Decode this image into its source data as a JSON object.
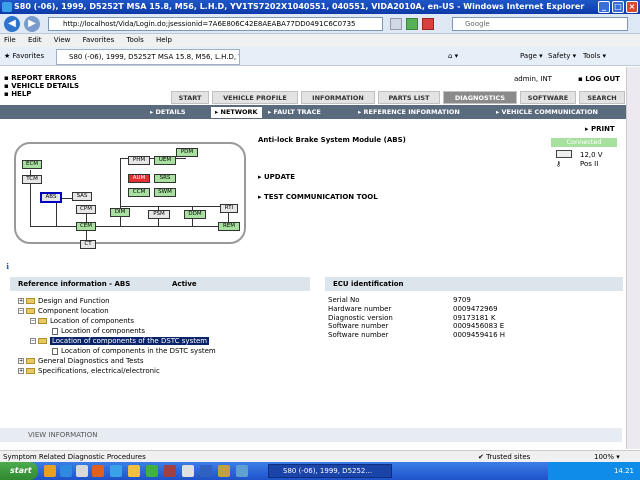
{
  "window": {
    "title": "S80 (-06), 1999, D5252T MSA 15.8, M56, L.H.D, YV1TS7202X1040551, 040551, VIDA2010A, en-US - Windows Internet Explorer"
  },
  "browser": {
    "address": "http://localhost/Vida/Login.do;jsessionid=7A6E806C42E8AEABA77DD0491C6C0735",
    "search_placeholder": "Google",
    "menu": [
      "File",
      "Edit",
      "View",
      "Favorites",
      "Tools",
      "Help"
    ],
    "favorites_label": "Favorites",
    "tab_title": "S80 (-06), 1999, D5252T MSA 15.8, M56, L.H.D, YV1...",
    "toolbar": {
      "page": "Page ▾",
      "safety": "Safety ▾",
      "tools": "Tools ▾"
    },
    "status": "Symptom Related Diagnostic Procedures",
    "zone": "Trusted sites",
    "zoom": "100% ▾"
  },
  "vida": {
    "left_links": [
      "REPORT ERRORS",
      "VEHICLE DETAILS",
      "HELP"
    ],
    "user": "admin, INT",
    "logout": "LOG OUT",
    "tabs": [
      "START",
      "VEHICLE PROFILE",
      "INFORMATION",
      "PARTS LIST",
      "DIAGNOSTICS",
      "SOFTWARE",
      "SEARCH"
    ],
    "subtabs": [
      "DETAILS",
      "NETWORK",
      "FAULT TRACE",
      "REFERENCE INFORMATION",
      "VEHICLE COMMUNICATION"
    ],
    "module_title": "Anti-lock Brake System Module (ABS)",
    "actions": [
      "UPDATE",
      "TEST COMMUNICATION TOOL"
    ],
    "print": "PRINT",
    "connection": "Connected",
    "voltage": "12,0 V",
    "ignition": "Pos II",
    "network_nodes": [
      "ECM",
      "TCM",
      "ABS",
      "SAS",
      "CPM",
      "CEM",
      "CT",
      "DIM",
      "PHM",
      "UEM",
      "PDM",
      "AUM",
      "SRS",
      "CCM",
      "SWM",
      "PSM",
      "DDM",
      "RTI",
      "REM"
    ],
    "ref_header": "Reference information - ABS",
    "ref_status": "Active",
    "tree": [
      "Design and Function",
      "Component location",
      "Location of components",
      "Location of components",
      "Location of components of the DSTC system",
      "Location of components in the DSTC system",
      "General Diagnostics and Tests",
      "Specifications, electrical/electronic"
    ],
    "ecu_header": "ECU identification",
    "ecu_rows": [
      {
        "label": "Serial No",
        "value": "9709"
      },
      {
        "label": "Hardware number",
        "value": "0009472969"
      },
      {
        "label": "Diagnostic version",
        "value": "09173181  K"
      },
      {
        "label": "Software number",
        "value": "0009456083  E"
      },
      {
        "label": "Software number",
        "value": "0009459416  H"
      }
    ],
    "view_info": "VIEW INFORMATION"
  },
  "taskbar": {
    "start": "start",
    "task": "S80 (-06), 1999, D5252...",
    "clock": "14.21"
  }
}
